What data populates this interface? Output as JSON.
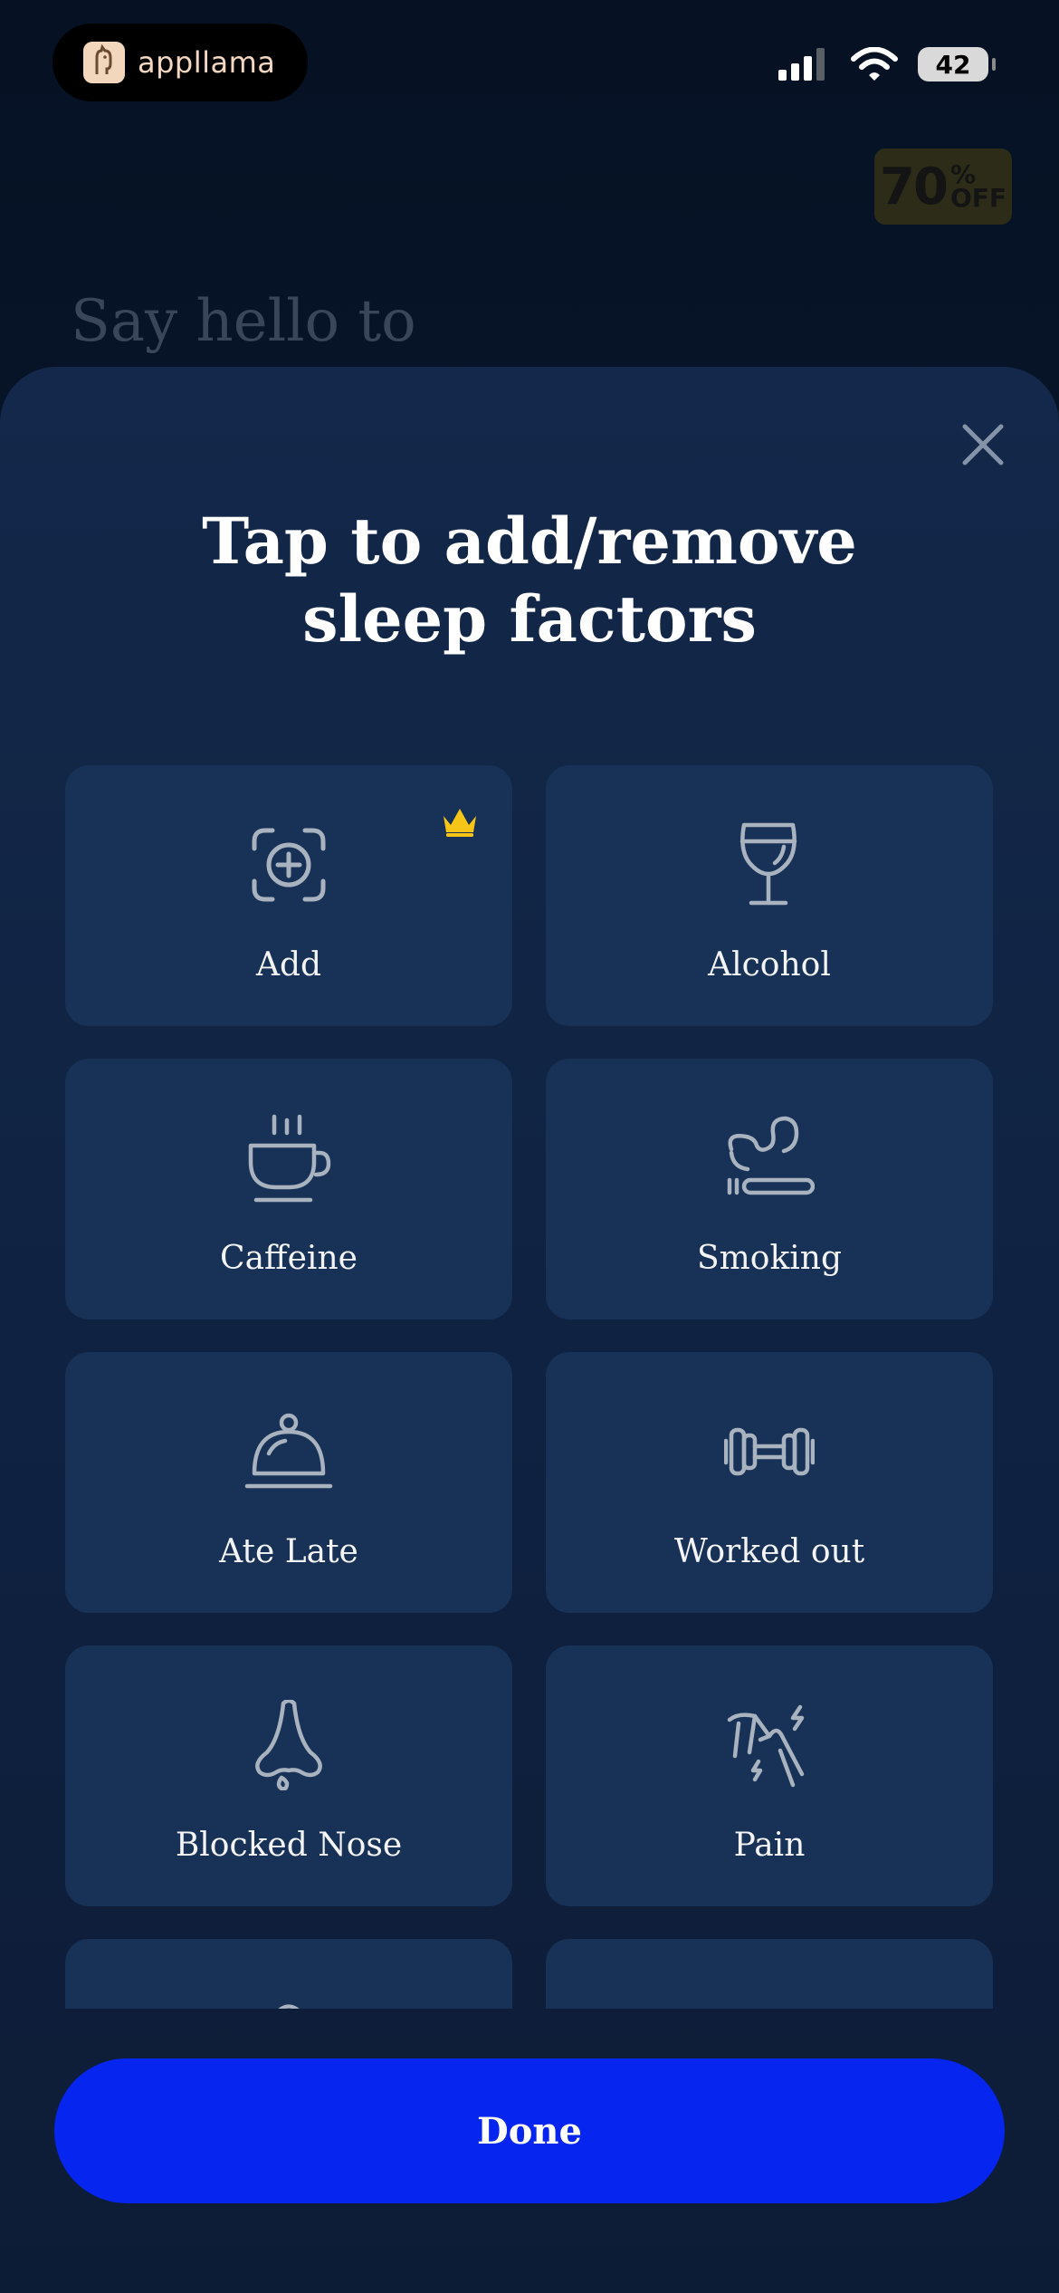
{
  "status_bar": {
    "brand": "appllama",
    "battery_level": "42",
    "icons": [
      "signal-icon",
      "wifi-icon",
      "battery-icon"
    ]
  },
  "background": {
    "sale_badge": {
      "number": "70",
      "percent": "%",
      "off": "OFF"
    },
    "heading_partial": "Say hello to"
  },
  "sheet": {
    "title_line1": "Tap to add/remove",
    "title_line2": "sleep factors",
    "close_icon": "close-icon",
    "factors": [
      {
        "label": "Add",
        "icon": "add-scan-icon",
        "premium": true
      },
      {
        "label": "Alcohol",
        "icon": "wine-glass-icon",
        "premium": false
      },
      {
        "label": "Caffeine",
        "icon": "coffee-cup-icon",
        "premium": false
      },
      {
        "label": "Smoking",
        "icon": "cigarette-icon",
        "premium": false
      },
      {
        "label": "Ate Late",
        "icon": "food-cloche-icon",
        "premium": false
      },
      {
        "label": "Worked out",
        "icon": "dumbbell-icon",
        "premium": false
      },
      {
        "label": "Blocked Nose",
        "icon": "nose-icon",
        "premium": false
      },
      {
        "label": "Pain",
        "icon": "pain-joint-icon",
        "premium": false
      }
    ],
    "done_label": "Done"
  },
  "colors": {
    "sheet_bg": "#13284a",
    "card_bg": "#173256",
    "accent_button": "#0625ee",
    "crown": "#f6c518",
    "icon_stroke": "#a9b2bf"
  }
}
